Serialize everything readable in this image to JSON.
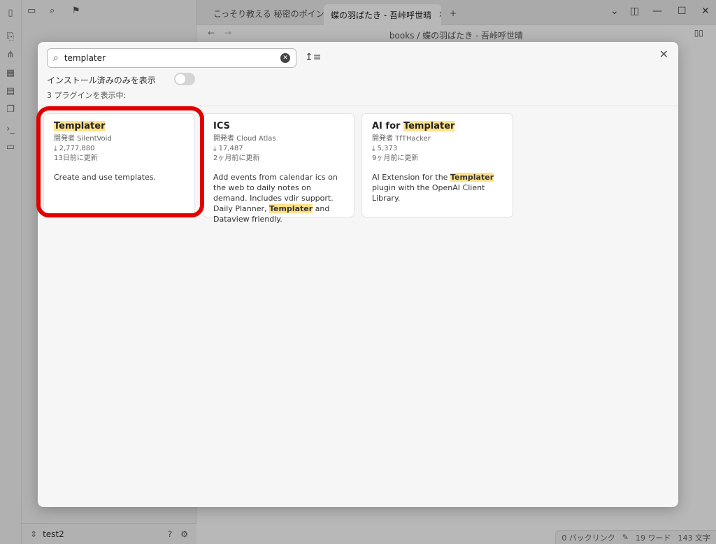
{
  "tabs": [
    {
      "label": "こっそり教える 秘密のポイン…"
    },
    {
      "label": "蝶の羽ばたき - 吾峠呼世晴"
    }
  ],
  "breadcrumb": "books / 蝶の羽ばたき - 吾峠呼世晴",
  "vault_name": "test2",
  "status": {
    "backlinks": "0 バックリンク",
    "words": "19 ワード",
    "chars": "143 文字"
  },
  "modal": {
    "search_value": "templater",
    "installed_only_label": "インストール済みのみを表示",
    "count_label": "3 プラグインを表示中:",
    "cards": [
      {
        "title_pre": "",
        "title_hl": "Templater",
        "title_post": "",
        "author": "開発者 SilentVoid",
        "downloads": "2,777,880",
        "updated": "13日前に更新",
        "desc_pre": "Create and use templates.",
        "desc_hl": "",
        "desc_post": ""
      },
      {
        "title_pre": "ICS",
        "title_hl": "",
        "title_post": "",
        "author": "開発者 Cloud Atlas",
        "downloads": "17,487",
        "updated": "2ヶ月前に更新",
        "desc_pre": "Add events from calendar ics on the web to daily notes on demand. Includes vdir support. Daily Planner, ",
        "desc_hl": "Templater",
        "desc_post": " and Dataview friendly."
      },
      {
        "title_pre": "AI for ",
        "title_hl": "Templater",
        "title_post": "",
        "author": "開発者 TfTHacker",
        "downloads": "5,373",
        "updated": "9ヶ月前に更新",
        "desc_pre": "AI Extension for the ",
        "desc_hl": "Templater",
        "desc_post": " plugin with the OpenAI Client Library."
      }
    ]
  },
  "colors": {
    "highlight": "#ffe28a",
    "outline": "#e00000"
  }
}
